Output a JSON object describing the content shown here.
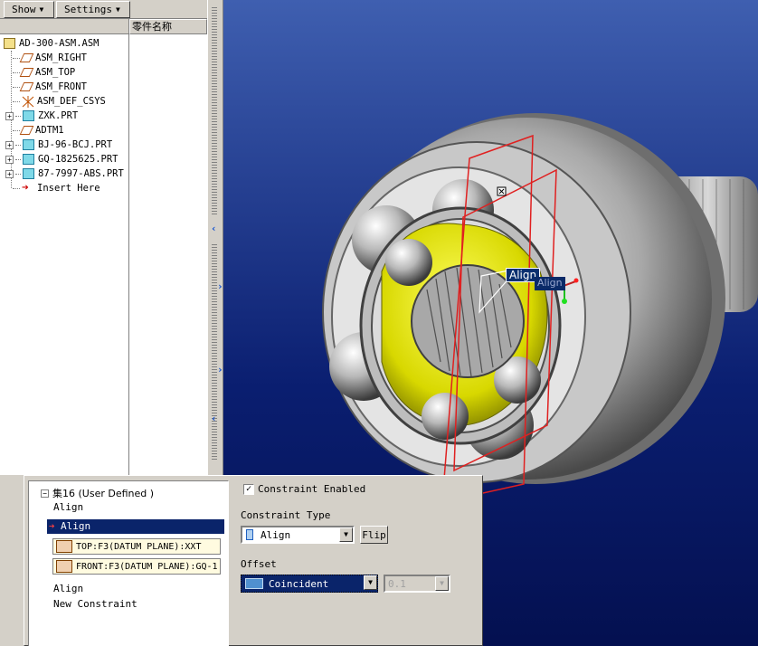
{
  "toolbar": {
    "show_label": "Show",
    "settings_label": "Settings"
  },
  "tree": {
    "name_column_header": "零件名称",
    "items": [
      {
        "label": "AD-300-ASM.ASM",
        "icon": "assembly-icon"
      },
      {
        "label": "ASM_RIGHT",
        "icon": "datum-plane-icon"
      },
      {
        "label": "ASM_TOP",
        "icon": "datum-plane-icon"
      },
      {
        "label": "ASM_FRONT",
        "icon": "datum-plane-icon"
      },
      {
        "label": "ASM_DEF_CSYS",
        "icon": "csys-icon"
      },
      {
        "label": "ZXK.PRT",
        "icon": "part-icon"
      },
      {
        "label": "ADTM1",
        "icon": "datum-plane-icon"
      },
      {
        "label": "BJ-96-BCJ.PRT",
        "icon": "part-icon"
      },
      {
        "label": "GQ-1825625.PRT",
        "icon": "part-icon"
      },
      {
        "label": "87-7997-ABS.PRT",
        "icon": "part-icon"
      },
      {
        "label": "Insert Here",
        "icon": "insert-arrow-icon"
      }
    ]
  },
  "viewport": {
    "align_tag_1": "Align",
    "align_tag_2": "Align"
  },
  "dialog": {
    "set_label": "集16 (User Defined )",
    "constraints": [
      "Align",
      "Align",
      "Align",
      "New Constraint"
    ],
    "references": [
      "TOP:F3(DATUM PLANE):XXT",
      "FRONT:F3(DATUM PLANE):GQ-1"
    ],
    "constraint_enabled_label": "Constraint Enabled",
    "constraint_enabled": true,
    "constraint_type_label": "Constraint Type",
    "constraint_type_value": "Align",
    "flip_label": "Flip",
    "offset_label": "Offset",
    "offset_value": "Coincident",
    "offset_amount": "0.1"
  },
  "colors": {
    "selection": "#0a246a",
    "viewport_top": "#3f5fb0",
    "viewport_bottom": "#041050",
    "part_yellow": "#e6e600"
  }
}
